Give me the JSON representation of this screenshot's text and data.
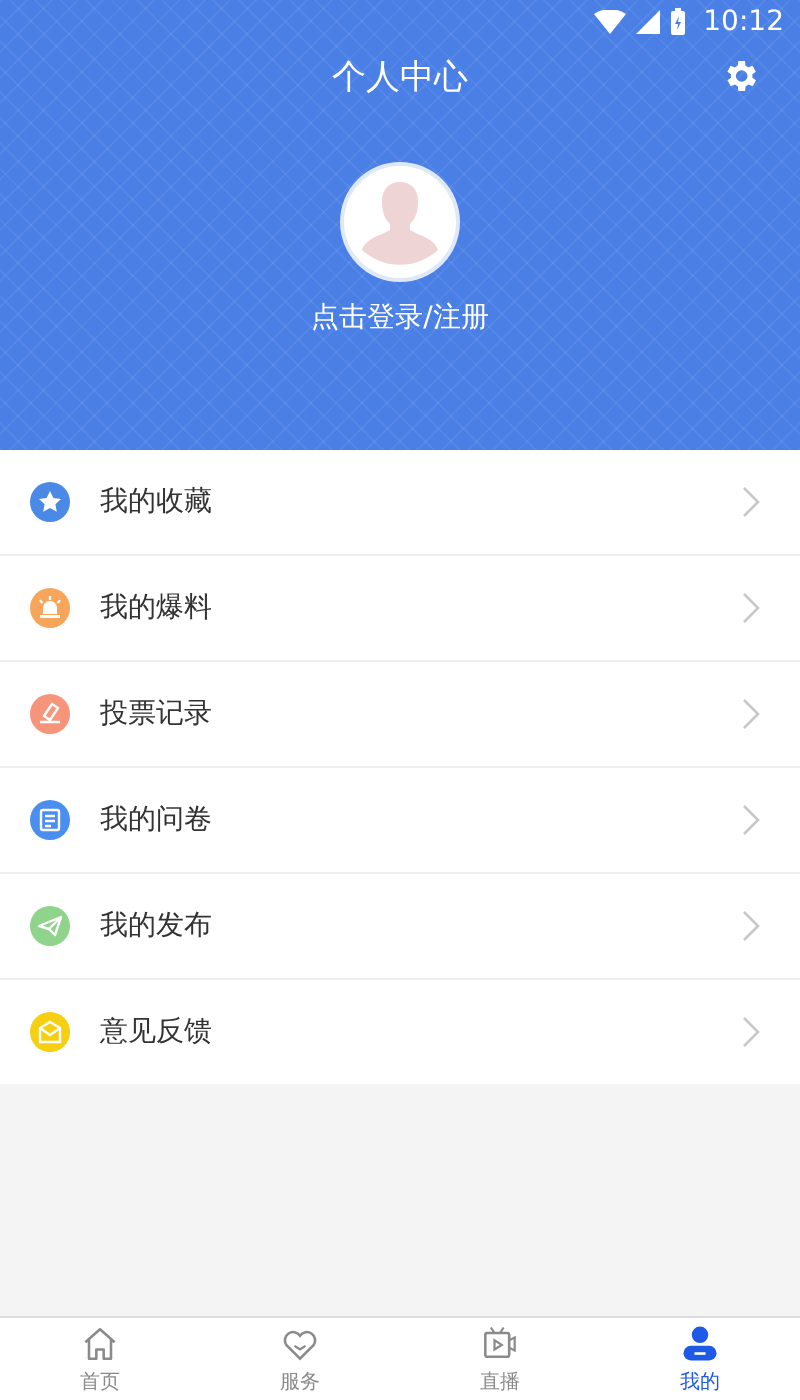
{
  "status_bar": {
    "time": "10:12"
  },
  "header": {
    "title": "个人中心",
    "login_text": "点击登录/注册"
  },
  "menu": [
    {
      "label": "我的收藏",
      "color": "#4a8ae6"
    },
    {
      "label": "我的爆料",
      "color": "#f8a55c"
    },
    {
      "label": "投票记录",
      "color": "#f7957a"
    },
    {
      "label": "我的问卷",
      "color": "#4a8ef0"
    },
    {
      "label": "我的发布",
      "color": "#8fd48a"
    },
    {
      "label": "意见反馈",
      "color": "#f5cf10"
    }
  ],
  "tab_bar": [
    {
      "label": "首页",
      "selected": false
    },
    {
      "label": "服务",
      "selected": false
    },
    {
      "label": "直播",
      "selected": false
    },
    {
      "label": "我的",
      "selected": true
    }
  ]
}
